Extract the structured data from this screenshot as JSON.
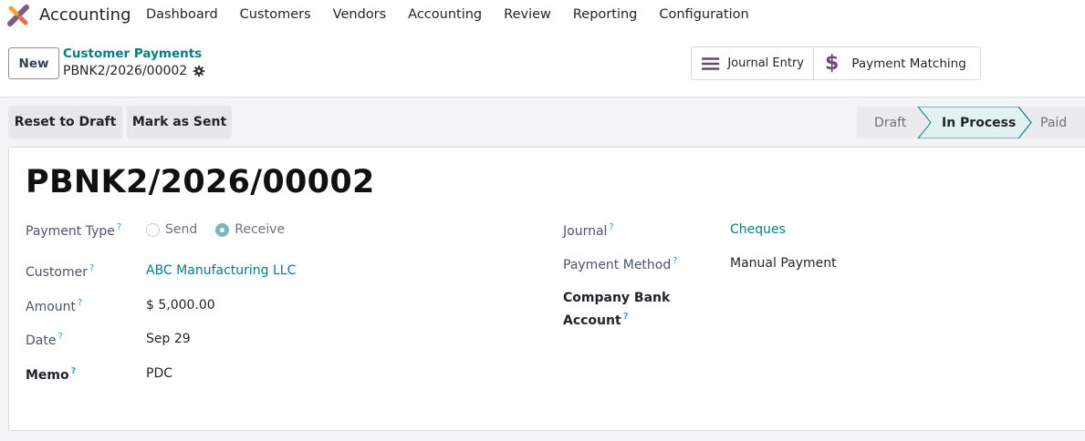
{
  "navbar": {
    "app_name": "Accounting",
    "menu": [
      "Dashboard",
      "Customers",
      "Vendors",
      "Accounting",
      "Review",
      "Reporting",
      "Configuration"
    ]
  },
  "control": {
    "new_label": "New",
    "breadcrumb": "Customer Payments",
    "record_name": "PBNK2/2026/00002",
    "smart_buttons": [
      {
        "label": "Journal Entry",
        "icon": "list-icon"
      },
      {
        "label": "Payment Matching",
        "icon": "dollar-icon"
      }
    ]
  },
  "actions": {
    "reset_label": "Reset to Draft",
    "sent_label": "Mark as Sent"
  },
  "stages": {
    "items": [
      "Draft",
      "In Process",
      "Paid"
    ],
    "active": "In Process"
  },
  "form": {
    "title": "PBNK2/2026/00002",
    "payment_type": {
      "label": "Payment Type",
      "help": "?",
      "options": [
        "Send",
        "Receive"
      ],
      "selected": "Receive"
    },
    "customer": {
      "label": "Customer",
      "help": "?",
      "value": "ABC Manufacturing LLC"
    },
    "amount": {
      "label": "Amount",
      "help": "?",
      "value": "$ 5,000.00"
    },
    "date": {
      "label": "Date",
      "help": "?",
      "value": "Sep 29"
    },
    "memo": {
      "label": "Memo",
      "help": "?",
      "value": "PDC"
    },
    "journal": {
      "label": "Journal",
      "help": "?",
      "value": "Cheques"
    },
    "payment_method": {
      "label": "Payment Method",
      "help": "?",
      "value": "Manual Payment"
    },
    "company_bank": {
      "label_line1": "Company Bank",
      "label_line2": "Account",
      "help": "?"
    }
  },
  "colors": {
    "accent": "#017e84",
    "status_active_border": "#017e84",
    "help_mark": "#3a9fd6",
    "logo_purple": "#7c5a8c",
    "logo_orange": "#f0a43a"
  }
}
